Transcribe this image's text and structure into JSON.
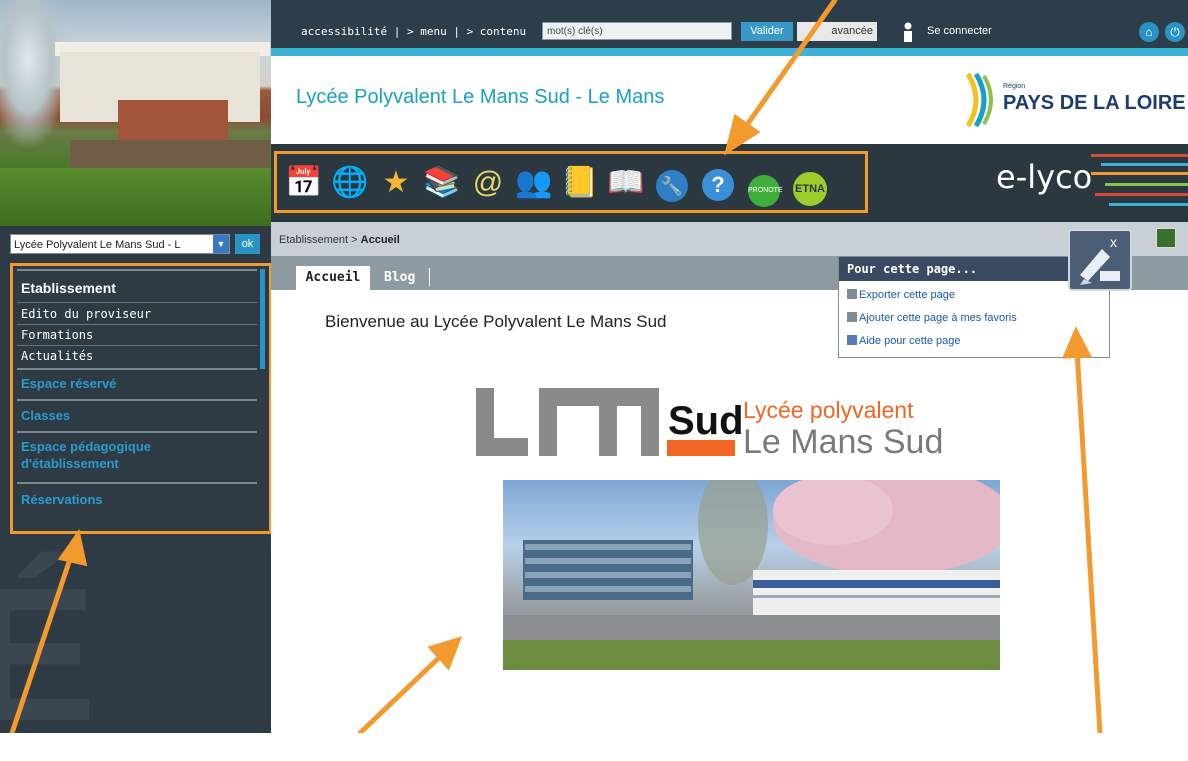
{
  "topbar": {
    "links": "accessibilité | > menu | > contenu",
    "search_placeholder": "mot(s) clé(s)",
    "valider": "Valider",
    "avancee": "avancée",
    "login": "Se connecter"
  },
  "header": {
    "school_title": "Lycée Polyvalent Le Mans Sud - Le Mans",
    "region_small": "Région",
    "region_name": "PAYS DE LA LOIRE",
    "brand": "e-lyco"
  },
  "toolbar_icons": [
    "calendar-icon",
    "mail-icon",
    "favorites-star-icon",
    "resources-icon",
    "webmail-icon",
    "directory-icon",
    "notebook-icon",
    "textbook-icon",
    "tools-icon",
    "help-icon",
    "pronote-icon",
    "etna-icon"
  ],
  "toolbar_labels": {
    "pronote": "PRONOTE",
    "etna": "ETNA"
  },
  "sidebar": {
    "select_value": "Lycée Polyvalent Le Mans Sud - L",
    "ok": "ok",
    "section_title": "Etablissement",
    "sub_items": [
      "Edito du proviseur",
      "Formations",
      "Actualités"
    ],
    "sections": [
      "Espace réservé",
      "Classes",
      "Espace pédagogique d'établissement",
      "Réservations"
    ]
  },
  "breadcrumb": {
    "parent": "Etablissement",
    "separator": ">",
    "current": "Accueil"
  },
  "tabs": [
    "Accueil",
    "Blog"
  ],
  "content": {
    "welcome": "Bienvenue au Lycée Polyvalent Le Mans Sud",
    "logo_text": "LM",
    "logo_sud": "Sud",
    "logo_line1": "Lycée polyvalent",
    "logo_line2": "Le Mans Sud"
  },
  "popup": {
    "title": "Pour cette page...",
    "items": [
      "Exporter cette page",
      "Ajouter cette page à mes favoris",
      "Aide pour cette page"
    ]
  },
  "colors": {
    "accent": "#f29a2e",
    "brand_blue": "#1aa0c7",
    "dark": "#2c3e49"
  }
}
